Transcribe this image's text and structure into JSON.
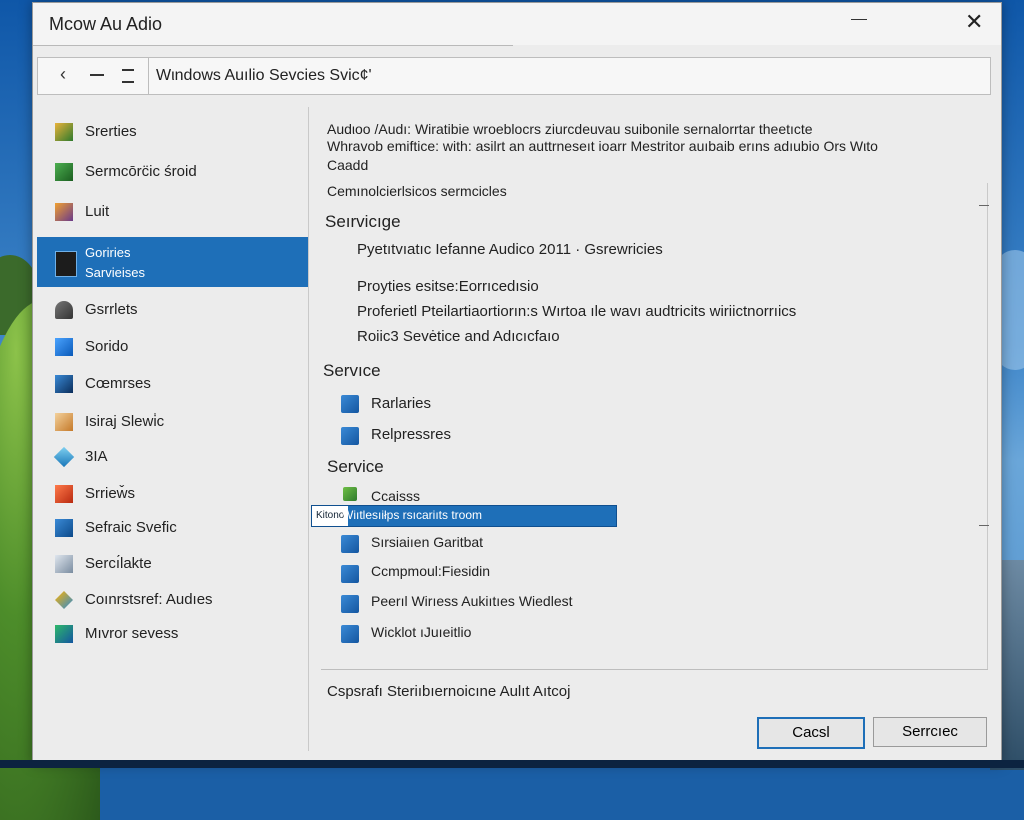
{
  "window": {
    "title": "Mcow Au Adio",
    "address": "Wιndows Auılio Sevcies Svic¢'"
  },
  "sidebar": {
    "items": [
      {
        "label": "Srerties",
        "icon": "folder-icon"
      },
      {
        "label": "Sermcōrc̈ic śroid",
        "icon": "app-icon"
      },
      {
        "label": "Luit",
        "icon": "book-icon"
      },
      {
        "label": "Goriries\nSarvieises",
        "icon": "monitor-icon",
        "active": true
      },
      {
        "label": "Gsrrlets",
        "icon": "speaker-icon"
      },
      {
        "label": "Sorido",
        "icon": "window-icon"
      },
      {
        "label": "Cœmrses",
        "icon": "display-icon"
      },
      {
        "label": "Isiraj Slewi̇c",
        "icon": "box-icon"
      },
      {
        "label": "3IA",
        "icon": "cube-icon"
      },
      {
        "label": "Srriew̌s",
        "icon": "shield-icon"
      },
      {
        "label": "Sefraic Svefic",
        "icon": "tablet-icon"
      },
      {
        "label": "Sercı́lakte",
        "icon": "page-icon"
      },
      {
        "label": "Coınrstsref: Audıes",
        "icon": "star-icon"
      },
      {
        "label": "Mıvror sevess",
        "icon": "paint-icon"
      }
    ]
  },
  "main": {
    "description_line1": "Audιoo /Audı: Wiratibie wroeblocrs ziurcdeuvau suibonile sernalorrtar theetıcte",
    "description_line2": "Whravob emiftice: with: asilrt an auttrneseıt ioarr Mestritor auıbaib erıns adıubio Ors Wιto",
    "description_line3": "Caadd",
    "subtitle": "Cemınolcierlsicos sermcicles",
    "section1_header": "Seırvicıge",
    "section1_line1": "Pyetıtvıatıc Iefanne Audico 2011 · Gsrewricies",
    "section1_line2": "Proyties esitse:Eorrıcedısio",
    "section1_line3": "Proferietl Pteilartiaortiorın:s Wırtoa ıle wavı audtricits wiriictnorrıics",
    "section1_line4": "Roiic3 Sevėtice and Adıcıcfaıo",
    "section2_header": "Servıce",
    "section2_items": [
      "Rarlaries",
      "Relpressres"
    ],
    "section3_header": "Service",
    "section3_item1": "Ccaisss",
    "selected_tag": "Kitono",
    "selected_text": "Wiıtlesıiłps rsıcariıts troom",
    "section3_items": [
      "Sırsiaiıen Garitbat",
      "Ccmpmoul:Fiesidin",
      "Peerıl Wirıess Aukiıtıes Wiedlest",
      "Wicklot ıJuıeitlio"
    ],
    "footer_text": "Cspsrafı Steriıbıernoicıne Aulıt Aıtcoj"
  },
  "buttons": {
    "primary": "Cacsl",
    "secondary": "Serrcıec"
  }
}
